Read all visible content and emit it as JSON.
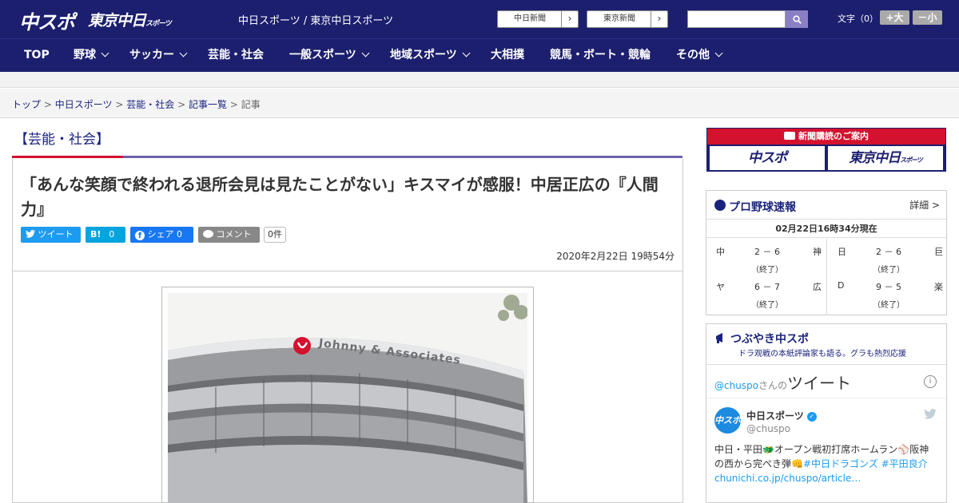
{
  "header": {
    "logo_main": "中スポ",
    "logo_tokyo": "東京中日",
    "logo_tokyo_suffix": "スポーツ",
    "site_name": "中日スポーツ / 東京中日スポーツ",
    "links": [
      {
        "label": "中日新聞"
      },
      {
        "label": "東京新聞"
      }
    ],
    "search": {
      "value": "",
      "placeholder": ""
    },
    "font_size_label": "文字（0）",
    "font_plus": "+大",
    "font_minus": "－小"
  },
  "nav": {
    "items": [
      {
        "label": "TOP"
      },
      {
        "label": "野球"
      },
      {
        "label": "サッカー"
      },
      {
        "label": "芸能・社会"
      },
      {
        "label": "一般スポーツ"
      },
      {
        "label": "地域スポーツ"
      },
      {
        "label": "大相撲"
      },
      {
        "label": "競馬・ボート・競輪"
      },
      {
        "label": "その他"
      }
    ]
  },
  "breadcrumb": {
    "items": [
      "トップ",
      "中日スポーツ",
      "芸能・社会",
      "記事一覧"
    ],
    "current": "記事",
    "separator": ">"
  },
  "section": {
    "title": "【芸能・社会】"
  },
  "article": {
    "headline": "「あんな笑顔で終われる退所会見は見たことがない」キスマイが感服！中居正広の『人間力』",
    "social": {
      "tweet": "ツイート",
      "hatena_label": "B!",
      "hatena_count": "0",
      "facebook": "シェア",
      "facebook_count": "0",
      "comment": "コメント",
      "comment_count": "0件"
    },
    "date": "2020年2月22日 19時54分",
    "photo_sign": "Johnny & Associates"
  },
  "sidebar": {
    "subscribe_title": "新聞購読のご案内",
    "subscribe_logo1": "中スポ",
    "subscribe_logo2": "東京中日",
    "subscribe_logo2_suffix": "スポーツ",
    "scores": {
      "title": "プロ野球速報",
      "detail": "詳細 >",
      "timestamp": "02月22日16時34分現在",
      "games": [
        {
          "team1": "中",
          "score": "2 － 6",
          "team2": "神",
          "status": "（終了）"
        },
        {
          "team1": "日",
          "score": "2 － 6",
          "team2": "巨",
          "status": "（終了）"
        },
        {
          "team1": "ヤ",
          "score": "6 － 7",
          "team2": "広",
          "status": "（終了）"
        },
        {
          "team1": "D",
          "score": "9 － 5",
          "team2": "楽",
          "status": "（終了）"
        }
      ]
    },
    "twitter": {
      "title": "つぶやき中スポ",
      "subtitle": "ドラ观戦の本紙評論家も語る。グラも熱烈応援",
      "header_user": "@chuspo",
      "header_suffix": "さんの",
      "header_big": "ツイート",
      "info": "i",
      "avatar_text": "中スポ",
      "name": "中日スポーツ",
      "handle": "@chuspo",
      "text_line1": "中日・平田🐲オープン戦初打席ホームラン⚾阪神",
      "text_line2": "の西から完ぺき弾👊",
      "tag1": "#中日ドラゴンズ",
      "tag2": "#平田良介",
      "link": "chunichi.co.jp/chuspo/article…"
    }
  },
  "colors": {
    "header_bg": "#1c1f6e",
    "accent_red": "#d4112e",
    "accent_purple": "#6a63a8",
    "twitter_blue": "#1d9bf0",
    "facebook_blue": "#1877f2",
    "hatena_blue": "#00a4de"
  }
}
